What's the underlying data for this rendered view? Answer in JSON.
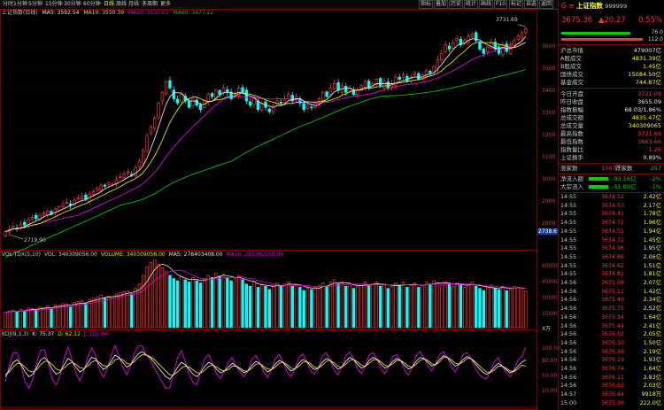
{
  "toolbar": {
    "periods": [
      "分时",
      "1分钟",
      "5分钟",
      "15分钟",
      "30分钟",
      "60分钟",
      "日线",
      "周线",
      "月线",
      "多周期",
      "更多"
    ],
    "active_period": "日线",
    "right_buttons": [
      "指标",
      "叠加",
      "历史",
      "统计",
      "画线",
      "F10",
      "标记",
      "自选",
      "返回"
    ]
  },
  "main_legend": {
    "name": "上证指数(日线)",
    "ma5": "MA5: 3592.54",
    "ma10": "MA10: 3550.39",
    "ma20": "MA20: 3505.01",
    "ma60": "MA60: 3477.22"
  },
  "main_axis": [
    "3600",
    "3500",
    "3400",
    "3300",
    "3200",
    "3100",
    "3000",
    "2900",
    "2800"
  ],
  "main_marks": {
    "high": "3731.69",
    "low": "2719.90",
    "axis_tag": "2738.6"
  },
  "vol_legend": {
    "title": "VOL-TDX(5,10)",
    "vol": "VOL: 340309056.00",
    "volume": "VOLUME: 340309056.00",
    "ma5": "MA5: 278403408.00",
    "ma10": "MA10: 282392558.00"
  },
  "vol_axis": [
    "60000",
    "45000",
    "30000",
    "15000"
  ],
  "vol_unit": "X万",
  "kdj_legend": {
    "title": "KDJ(9,3,3)",
    "k": "K: 75.37",
    "d": "D: 62.12",
    "j": "J: 101.86"
  },
  "kdj_axis": [
    "100.00",
    "80.00",
    "50.00",
    "20.00"
  ],
  "quote": {
    "code_prefix": "G ≡",
    "name": "上证指数",
    "code": "999999",
    "price": "3675.36",
    "change": "▲20.27",
    "pct": "0.55%",
    "bar_top_value": "76.0",
    "bar_bottom_value": "112.0"
  },
  "stats1": [
    {
      "label": "沪总市值",
      "value": "479007亿",
      "color": "wht"
    },
    {
      "label": "A股成交",
      "value": "4831.39亿",
      "color": "yel"
    },
    {
      "label": "B股成交",
      "value": "1.45亿",
      "color": "yel"
    },
    {
      "label": "国债成交",
      "value": "15084.50亿",
      "color": "yel"
    },
    {
      "label": "基金成交",
      "value": "744.87亿",
      "color": "yel"
    }
  ],
  "stats2": [
    {
      "label": "今日开盘",
      "value": "3721.09",
      "color": "red"
    },
    {
      "label": "昨日收盘",
      "value": "3655.09",
      "color": "wht"
    },
    {
      "label": "指数振幅",
      "value": "68.03/1.86%",
      "color": "wht"
    },
    {
      "label": "总成交额",
      "value": "4835.47亿",
      "color": "yel"
    },
    {
      "label": "总成交量",
      "value": "340309065",
      "color": "yel"
    },
    {
      "label": "最高指数",
      "value": "3731.69",
      "color": "red"
    },
    {
      "label": "最低指数",
      "value": "3663.66",
      "color": "red"
    },
    {
      "label": "指数量比",
      "value": "1.26",
      "color": "red"
    },
    {
      "label": "上证换手",
      "value": "0.89%",
      "color": "wht"
    }
  ],
  "breadth": {
    "up_label": "涨家数",
    "up": "1567",
    "down_label": "跌家数",
    "down": "257"
  },
  "flows": [
    {
      "label": "净流入额",
      "value": "-93.16亿",
      "pct": "-2%"
    },
    {
      "label": "大宗流入",
      "value": "-51.89亿",
      "pct": "-1%"
    }
  ],
  "ticks": [
    [
      "14:55",
      "3674.52",
      "2.42亿"
    ],
    [
      "14:55",
      "3674.53",
      "2.17亿"
    ],
    [
      "14:55",
      "3674.41",
      "1.78亿"
    ],
    [
      "14:55",
      "3674.72",
      "1.96亿"
    ],
    [
      "14:55",
      "3674.51",
      "1.94亿"
    ],
    [
      "14:55",
      "3674.72",
      "1.45亿"
    ],
    [
      "14:55",
      "3674.96",
      "1.95亿"
    ],
    [
      "14:55",
      "3674.86",
      "2.06亿"
    ],
    [
      "14:55",
      "3674.62",
      "1.51亿"
    ],
    [
      "14:55",
      "3674.81",
      "1.81亿"
    ],
    [
      "14:56",
      "3675.08",
      "2.07亿"
    ],
    [
      "14:56",
      "3675.11",
      "1.42亿"
    ],
    [
      "14:56",
      "3675.49",
      "2.34亿"
    ],
    [
      "14:56",
      "3675.75",
      "2.52亿"
    ],
    [
      "14:56",
      "3675.94",
      "1.64亿"
    ],
    [
      "14:56",
      "3675.44",
      "2.41亿"
    ],
    [
      "14:56",
      "3676.02",
      "2.05亿"
    ],
    [
      "14:56",
      "3676.30",
      "1.50亿"
    ],
    [
      "14:56",
      "3676.38",
      "2.19亿"
    ],
    [
      "14:56",
      "3676.19",
      "1.93亿"
    ],
    [
      "14:56",
      "3676.74",
      "1.64亿"
    ],
    [
      "14:56",
      "3676.11",
      "2.83亿"
    ],
    [
      "14:56",
      "3676.63",
      "2.03亿"
    ],
    [
      "14:57",
      "3676.44",
      "9918万"
    ],
    [
      "15:00",
      "3675.36",
      "222.0亿"
    ]
  ],
  "colors": {
    "up": "#ff3030",
    "down": "#00ffff",
    "ma5": "#e0e0e0",
    "ma10": "#e0e000",
    "ma20": "#e000e0",
    "ma60": "#00c000",
    "grid": "#7a0000"
  },
  "chart_data": [
    {
      "type": "candlestick",
      "title": "上证指数(日线)",
      "ylim": [
        2700,
        3750
      ],
      "close": [
        2735,
        2745,
        2760,
        2750,
        2770,
        2765,
        2790,
        2800,
        2795,
        2810,
        2820,
        2830,
        2815,
        2840,
        2850,
        2860,
        2870,
        2855,
        2880,
        2890,
        2900,
        2885,
        2910,
        2920,
        2935,
        2950,
        2945,
        2960,
        2955,
        2975,
        2990,
        3000,
        3010,
        2995,
        3030,
        3060,
        3110,
        3180,
        3220,
        3260,
        3330,
        3380,
        3430,
        3400,
        3350,
        3330,
        3370,
        3340,
        3310,
        3350,
        3320,
        3300,
        3340,
        3370,
        3360,
        3390,
        3370,
        3400,
        3380,
        3350,
        3370,
        3400,
        3380,
        3340,
        3320,
        3350,
        3300,
        3330,
        3310,
        3290,
        3320,
        3340,
        3330,
        3350,
        3370,
        3340,
        3360,
        3330,
        3300,
        3320,
        3310,
        3330,
        3350,
        3380,
        3360,
        3400,
        3420,
        3390,
        3410,
        3380,
        3400,
        3370,
        3390,
        3410,
        3430,
        3400,
        3420,
        3440,
        3410,
        3430,
        3400,
        3420,
        3450,
        3440,
        3460,
        3430,
        3450,
        3470,
        3440,
        3460,
        3480,
        3470,
        3500,
        3530,
        3560,
        3600,
        3580,
        3610,
        3630,
        3600,
        3620,
        3640,
        3650,
        3620,
        3580,
        3560,
        3590,
        3610,
        3580,
        3560,
        3600,
        3570,
        3600,
        3620,
        3640,
        3655,
        3675
      ],
      "ma_series": [
        "MA5",
        "MA10",
        "MA20",
        "MA60"
      ]
    },
    {
      "type": "bar",
      "title": "VOL-TDX(5,10)",
      "ylim": [
        0,
        65000
      ],
      "values": [
        14000,
        15000,
        16000,
        14500,
        17000,
        15500,
        18000,
        17500,
        16000,
        19000,
        18500,
        20000,
        17000,
        21000,
        20500,
        22000,
        21500,
        19000,
        23000,
        24000,
        25000,
        22000,
        26000,
        27000,
        28000,
        30000,
        27000,
        29000,
        28000,
        31000,
        32000,
        33000,
        34000,
        31000,
        36000,
        40000,
        48000,
        56000,
        60000,
        62000,
        58000,
        55000,
        52000,
        48000,
        45000,
        43000,
        47000,
        44000,
        42000,
        46000,
        43000,
        41000,
        45000,
        48000,
        46000,
        50000,
        47000,
        49000,
        46000,
        43000,
        45000,
        48000,
        44000,
        40000,
        38000,
        42000,
        37000,
        40000,
        38000,
        35000,
        39000,
        41000,
        38000,
        40000,
        42000,
        38000,
        40000,
        37000,
        34000,
        36000,
        35000,
        37000,
        39000,
        41000,
        38000,
        42000,
        44000,
        40000,
        42000,
        38000,
        40000,
        36000,
        38000,
        40000,
        42000,
        38000,
        40000,
        42000,
        38000,
        40000,
        36000,
        38000,
        41000,
        39000,
        42000,
        37000,
        39000,
        41000,
        37000,
        39000,
        42000,
        40000,
        43000,
        41000,
        39000,
        42000,
        40000,
        38000,
        41000,
        39000,
        37000,
        40000,
        42000,
        38000,
        36000,
        34000,
        37000,
        39000,
        36000,
        35000,
        38000,
        34000,
        36000,
        38000,
        37000,
        36000,
        34000
      ]
    },
    {
      "type": "line",
      "title": "KDJ(9,3,3)",
      "ylim": [
        -20,
        120
      ],
      "series": [
        {
          "name": "K",
          "values": [
            40,
            55,
            70,
            75,
            65,
            50,
            40,
            45,
            60,
            75,
            80,
            70,
            55,
            45,
            50,
            65,
            78,
            72,
            60,
            50,
            55,
            68,
            80,
            78,
            65,
            55,
            60,
            72,
            85,
            80,
            70,
            60,
            65,
            78,
            88,
            92,
            85,
            80,
            70,
            60,
            50,
            40,
            35,
            45,
            60,
            70,
            65,
            55,
            45,
            40,
            50,
            62,
            70,
            65,
            55,
            48,
            52,
            60,
            68,
            62,
            55,
            48,
            52,
            64,
            72,
            68,
            58,
            50,
            55,
            66,
            74,
            70,
            60,
            52,
            56,
            68,
            76,
            72,
            62,
            55,
            58,
            70,
            78,
            74,
            64,
            56,
            60,
            72,
            80,
            76,
            66,
            58,
            62,
            74,
            80,
            76,
            66,
            58,
            62,
            72,
            78,
            74,
            64,
            56,
            60,
            72,
            80,
            78,
            70,
            62,
            66,
            76,
            84,
            80,
            70,
            62,
            66,
            76,
            82,
            78,
            68,
            58,
            50,
            45,
            50,
            60,
            68,
            62,
            55,
            48,
            52,
            62,
            70,
            75
          ]
        },
        {
          "name": "D",
          "values": [
            45,
            50,
            60,
            68,
            67,
            60,
            52,
            50,
            55,
            65,
            72,
            72,
            65,
            56,
            53,
            58,
            66,
            70,
            66,
            59,
            57,
            62,
            70,
            74,
            70,
            63,
            62,
            66,
            75,
            78,
            75,
            68,
            66,
            72,
            80,
            86,
            85,
            82,
            76,
            68,
            60,
            52,
            44,
            44,
            50,
            58,
            62,
            60,
            54,
            48,
            48,
            54,
            62,
            64,
            60,
            54,
            52,
            55,
            62,
            62,
            58,
            52,
            52,
            58,
            66,
            67,
            62,
            56,
            55,
            60,
            68,
            70,
            65,
            58,
            56,
            62,
            70,
            72,
            67,
            60,
            58,
            64,
            72,
            74,
            69,
            62,
            60,
            66,
            74,
            76,
            71,
            64,
            62,
            68,
            75,
            76,
            71,
            64,
            62,
            67,
            74,
            74,
            69,
            62,
            60,
            66,
            74,
            77,
            74,
            67,
            65,
            71,
            80,
            80,
            75,
            68,
            66,
            71,
            78,
            78,
            72,
            64,
            56,
            50,
            49,
            54,
            62,
            62,
            58,
            52,
            51,
            56,
            64,
            62
          ]
        },
        {
          "name": "J",
          "values": [
            30,
            65,
            90,
            89,
            61,
            30,
            16,
            35,
            70,
            95,
            96,
            66,
            35,
            23,
            44,
            79,
            102,
            76,
            48,
            32,
            51,
            80,
            100,
            86,
            55,
            39,
            56,
            84,
            105,
            84,
            60,
            44,
            63,
            90,
            104,
            104,
            85,
            76,
            58,
            44,
            30,
            16,
            17,
            47,
            80,
            94,
            71,
            45,
            27,
            24,
            54,
            78,
            86,
            67,
            45,
            36,
            52,
            70,
            80,
            62,
            49,
            40,
            52,
            76,
            84,
            70,
            50,
            38,
            55,
            78,
            86,
            70,
            50,
            40,
            56,
            80,
            88,
            72,
            52,
            45,
            58,
            82,
            90,
            74,
            54,
            44,
            60,
            84,
            92,
            76,
            56,
            46,
            62,
            86,
            90,
            76,
            56,
            46,
            62,
            82,
            86,
            74,
            54,
            44,
            60,
            84,
            92,
            80,
            62,
            52,
            68,
            86,
            92,
            80,
            60,
            50,
            66,
            86,
            90,
            78,
            60,
            46,
            38,
            35,
            52,
            72,
            80,
            62,
            49,
            40,
            54,
            74,
            82,
            101
          ]
        }
      ]
    }
  ]
}
